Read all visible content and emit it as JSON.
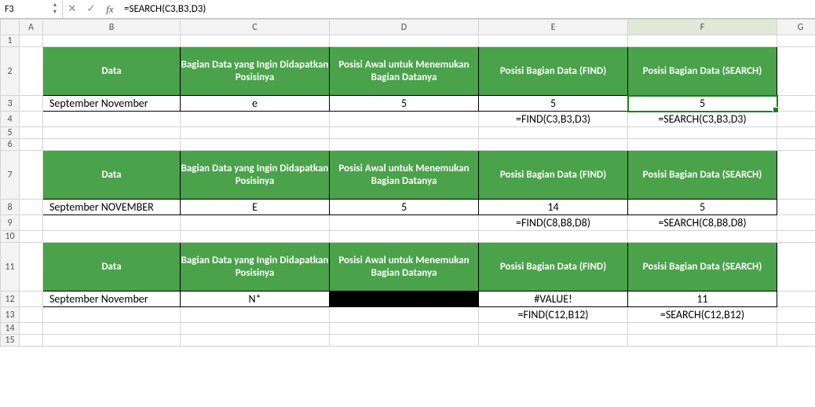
{
  "namebox": "F3",
  "formula": "=SEARCH(C3,B3,D3)",
  "columns": [
    "A",
    "B",
    "C",
    "D",
    "E",
    "F",
    "G"
  ],
  "rows": [
    "1",
    "2",
    "3",
    "4",
    "5",
    "6",
    "7",
    "8",
    "9",
    "10",
    "11",
    "12",
    "13",
    "14",
    "15"
  ],
  "hdr": {
    "data": "Data",
    "part": "Bagian Data yang Ingin Didapatkan Posisinya",
    "start": "Posisi Awal untuk Menemukan Bagian Datanya",
    "find": "Posisi Bagian Data (FIND)",
    "search": "Posisi Bagian Data (SEARCH)"
  },
  "t1": {
    "b": "September November",
    "c": "e",
    "d": "5",
    "e": "5",
    "f": "5",
    "noteE": "=FIND(C3,B3,D3)",
    "noteF": "=SEARCH(C3,B3,D3)"
  },
  "t2": {
    "b": "September NOVEMBER",
    "c": "E",
    "d": "5",
    "e": "14",
    "f": "5",
    "noteE": "=FIND(C8,B8,D8)",
    "noteF": "=SEARCH(C8,B8,D8)"
  },
  "t3": {
    "b": "September November",
    "c": "N*",
    "d": "",
    "e": "#VALUE!",
    "f": "11",
    "noteE": "=FIND(C12,B12)",
    "noteF": "=SEARCH(C12,B12)"
  },
  "chart_data": {
    "type": "table",
    "tables": [
      {
        "row": 3,
        "Data": "September November",
        "Bagian": "e",
        "Posisi_Awal": 5,
        "FIND": 5,
        "SEARCH": 5
      },
      {
        "row": 8,
        "Data": "September NOVEMBER",
        "Bagian": "E",
        "Posisi_Awal": 5,
        "FIND": 14,
        "SEARCH": 5
      },
      {
        "row": 12,
        "Data": "September November",
        "Bagian": "N*",
        "Posisi_Awal": null,
        "FIND": "#VALUE!",
        "SEARCH": 11
      }
    ]
  }
}
